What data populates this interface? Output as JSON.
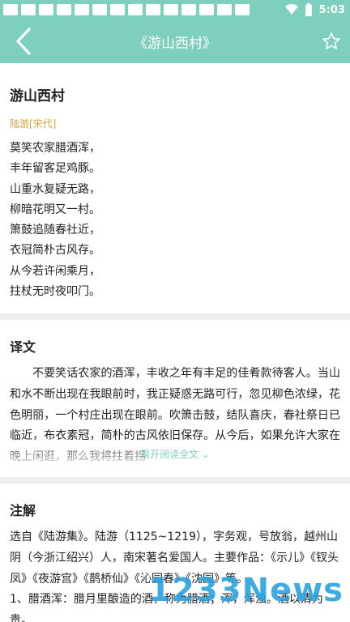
{
  "status_bar": {
    "time": "5:03",
    "wifi_icon": "wifi-icon",
    "battery_icon": "battery-icon"
  },
  "app_bar": {
    "title": "《游山西村》",
    "back_icon": "back-arrow-icon",
    "favorite_icon": "star-outline-icon"
  },
  "poem": {
    "title": "游山西村",
    "author": "陆游[宋代]",
    "lines": [
      "莫笑农家腊酒浑，",
      "丰年留客足鸡豚。",
      "山重水复疑无路，",
      "柳暗花明又一村。",
      "箫鼓追随春社近，",
      "衣冠简朴古风存。",
      "从今若许闲乘月，",
      "拄杖无时夜叩门。"
    ]
  },
  "translation": {
    "heading": "译文",
    "text": "不要笑话农家的酒浑，丰收之年有丰足的佳肴款待客人。当山和水不断出现在我眼前时，我正疑惑无路可行，忽见柳色浓绿，花色明丽，一个村庄出现在眼前。吹箫击鼓，结队喜庆，春社祭日已临近，布衣素冠，简朴的古风依旧保存。从今后，如果允许大家在晚上闲逛，那么我将拄着拐",
    "expand_label": "展开阅读全文 ⌄"
  },
  "notes": {
    "heading": "注解",
    "paragraphs": [
      "选自《陆游集》。陆游（1125~1219），字务观，号放翁，越州山阴（今浙江绍兴）人，南宋著名爱国人。主要作品：《示儿》《钗头凤》《夜游宫》《鹊桥仙》《沁园春》《沈园》等。",
      "1、腊酒浑：腊月里酿造的酒，称为腊酒；浑，浑浊。酒以清为贵。"
    ]
  },
  "watermark": {
    "text": "1233News"
  }
}
